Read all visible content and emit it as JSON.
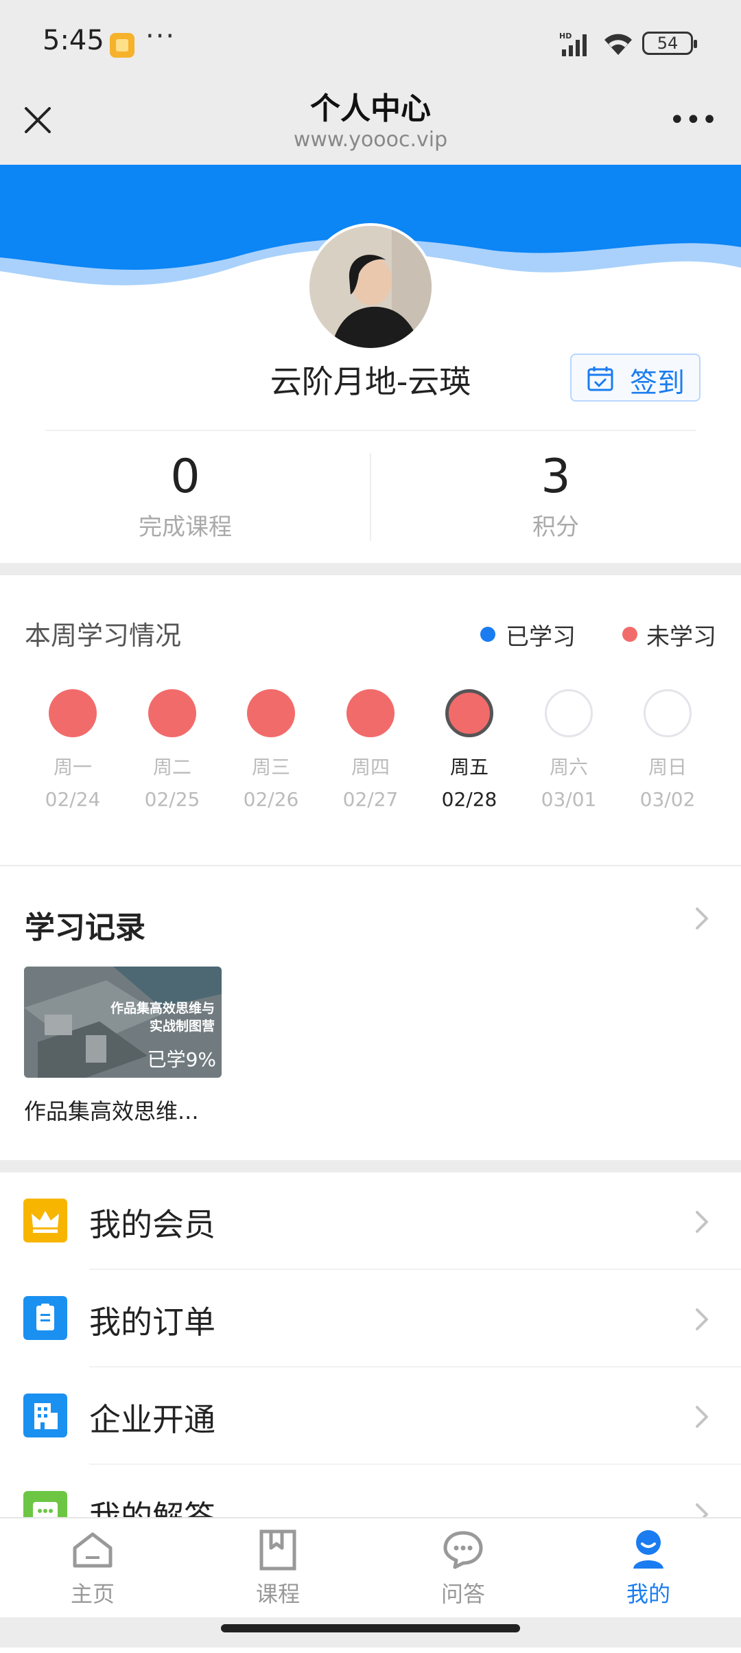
{
  "status_bar": {
    "time": "5:45",
    "dots": "···",
    "battery": "54"
  },
  "nav": {
    "title": "个人中心",
    "url": "www.yoooc.vip"
  },
  "profile": {
    "name": "云阶月地-云瑛",
    "checkin_label": "签到"
  },
  "stats": [
    {
      "value": "0",
      "label": "完成课程"
    },
    {
      "value": "3",
      "label": "积分"
    }
  ],
  "week": {
    "title": "本周学习情况",
    "legend_studied": "已学习",
    "legend_unstudied": "未学习",
    "days": [
      {
        "name": "周一",
        "date": "02/24",
        "status": "unstudied"
      },
      {
        "name": "周二",
        "date": "02/25",
        "status": "unstudied"
      },
      {
        "name": "周三",
        "date": "02/26",
        "status": "unstudied"
      },
      {
        "name": "周四",
        "date": "02/27",
        "status": "unstudied"
      },
      {
        "name": "周五",
        "date": "02/28",
        "status": "today"
      },
      {
        "name": "周六",
        "date": "03/01",
        "status": "future"
      },
      {
        "name": "周日",
        "date": "03/02",
        "status": "future"
      }
    ]
  },
  "records": {
    "title": "学习记录",
    "course": {
      "thumb_title": "作品集高效思维与实战制图营",
      "progress": "已学9%",
      "title": "作品集高效思维..."
    }
  },
  "menu": [
    {
      "label": "我的会员",
      "icon": "crown-icon",
      "color": "#f7b500"
    },
    {
      "label": "我的订单",
      "icon": "order-icon",
      "color": "#1a90f0"
    },
    {
      "label": "企业开通",
      "icon": "building-icon",
      "color": "#1a90f0"
    },
    {
      "label": "我的解答",
      "icon": "chat-icon",
      "color": "#6cc644"
    }
  ],
  "tabs": [
    {
      "label": "主页",
      "icon": "home-icon"
    },
    {
      "label": "课程",
      "icon": "bookmark-icon"
    },
    {
      "label": "问答",
      "icon": "chat-bubble-icon"
    },
    {
      "label": "我的",
      "icon": "profile-icon",
      "active": true
    }
  ],
  "colors": {
    "brand": "#1a7cf0",
    "studied": "#1a7cf0",
    "unstudied": "#f26b6b"
  }
}
